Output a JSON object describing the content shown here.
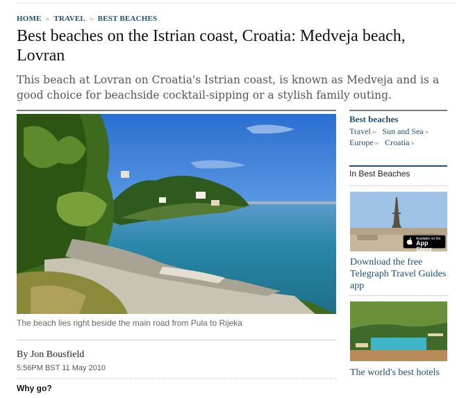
{
  "breadcrumb": [
    {
      "label": "HOME"
    },
    {
      "label": "TRAVEL"
    },
    {
      "label": "BEST BEACHES"
    }
  ],
  "breadcrumb_separator": "»",
  "headline": "Best beaches on the Istrian coast, Croatia: Medveja beach, Lovran",
  "standfirst": "This beach at Lovran on Croatia's Istrian coast, is known as Medveja and is a good choice for beachside cocktail-sipping or a stylish family outing.",
  "hero": {
    "caption": "The beach lies right beside the main road from Pula to Rijeka"
  },
  "byline": "By Jon Bousfield",
  "timestamp": "5:56PM BST 11 May 2010",
  "section_heading": "Why go?",
  "sidebar": {
    "tags_title": "Best beaches",
    "tags": [
      "Travel",
      "Sun and Sea",
      "Europe",
      "Croatia"
    ],
    "tag_chevron": "»",
    "in_section": "In Best Beaches",
    "promos": [
      {
        "title": "Download the free Telegraph Travel Guides app",
        "badge_small": "Available on the",
        "badge_large": "App Store"
      },
      {
        "title": "The world's best hotels"
      }
    ]
  },
  "colors": {
    "link": "#1f4e79",
    "text": "#111111",
    "muted": "#555555"
  }
}
